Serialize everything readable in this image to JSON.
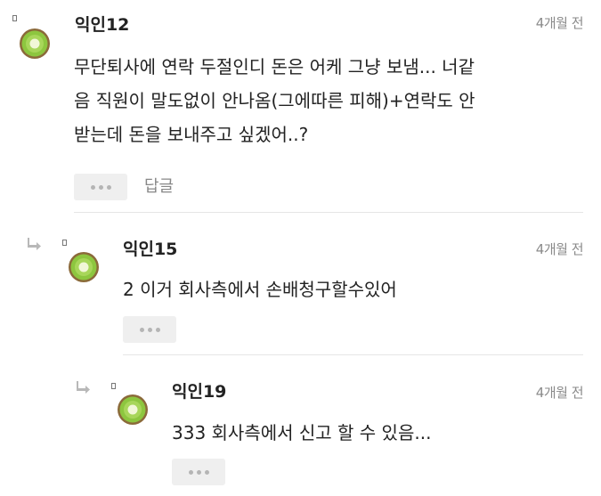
{
  "comments": [
    {
      "author": "익인12",
      "time": "4개월 전",
      "text": "무단퇴사에 연락 두절인디 돈은 어케 그냥 보냄... 너같\n음 직원이 말도없이 안나옴(그에따른 피해)+연락도 안\n받는데 돈을 보내주고 싶겠어..?",
      "reply_label": "답글"
    },
    {
      "author": "익인15",
      "time": "4개월 전",
      "text": "2 이거 회사측에서 손배청구할수있어"
    },
    {
      "author": "익인19",
      "time": "4개월 전",
      "text": "333 회사측에서 신고 할 수 있음..."
    }
  ],
  "icons": {
    "avatar": "kiwi-avatar-icon",
    "reply": "reply-arrow-icon",
    "more": "more-dots-icon"
  },
  "colors": {
    "kiwi_flesh": "#8dc63f",
    "kiwi_rim": "#5b8a2a",
    "muted_text": "#8a8a8a"
  }
}
